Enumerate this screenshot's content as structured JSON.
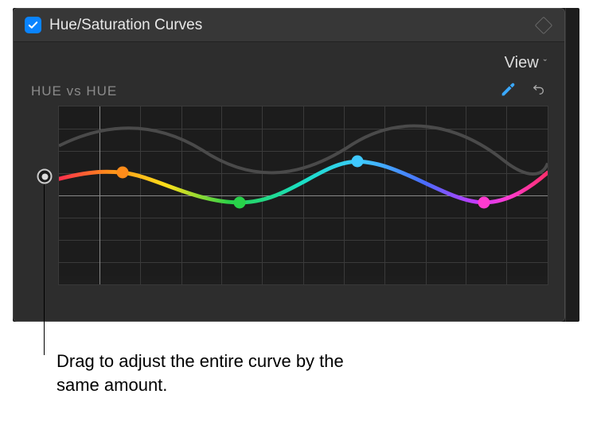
{
  "header": {
    "checkbox_checked": true,
    "title": "Hue/Saturation Curves"
  },
  "toolbar": {
    "view_label": "View"
  },
  "curve": {
    "title": "HUE vs HUE",
    "points": [
      {
        "name": "orange",
        "color": "#ff8c1a",
        "x_pct": 13,
        "y_pct": 37
      },
      {
        "name": "green",
        "color": "#28d24a",
        "x_pct": 37,
        "y_pct": 54
      },
      {
        "name": "cyan",
        "color": "#3fc9ff",
        "x_pct": 61,
        "y_pct": 31
      },
      {
        "name": "magenta",
        "color": "#ff3bd0",
        "x_pct": 87,
        "y_pct": 54
      }
    ]
  },
  "callout": {
    "text": "Drag to adjust the entire curve by the same amount."
  }
}
